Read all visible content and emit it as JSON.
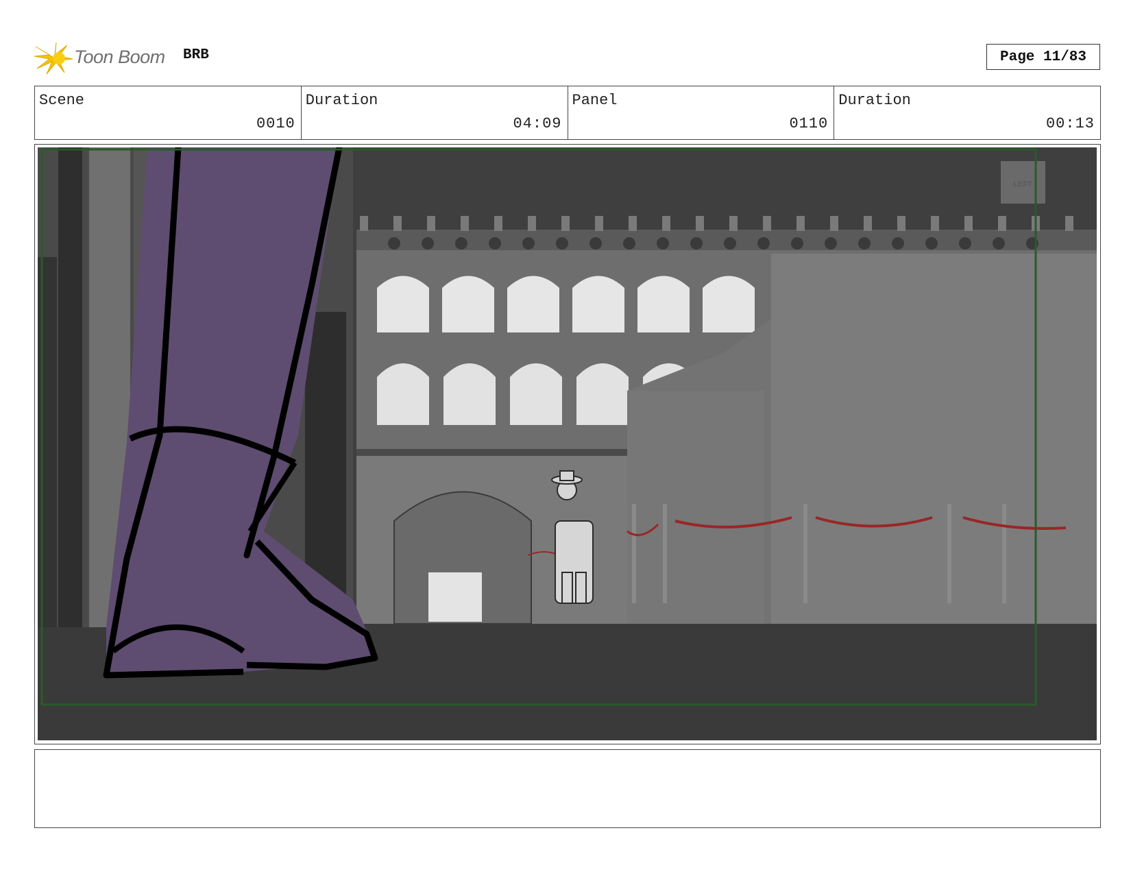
{
  "header": {
    "logo_text": "Toon Boom",
    "project": "BRB",
    "page": "Page 11/83"
  },
  "info": {
    "scene_label": "Scene",
    "scene_value": "0010",
    "scene_duration_label": "Duration",
    "scene_duration_value": "04:09",
    "panel_label": "Panel",
    "panel_value": "0110",
    "panel_duration_label": "Duration",
    "panel_duration_value": "00:13"
  },
  "panel": {
    "sign_text": "LEFT"
  },
  "notes": {
    "text": ""
  },
  "colors": {
    "logo_star": "#f5c400",
    "boot": "#5e4d70",
    "rope": "#9a2626",
    "frame_green": "#2a5a2a"
  }
}
